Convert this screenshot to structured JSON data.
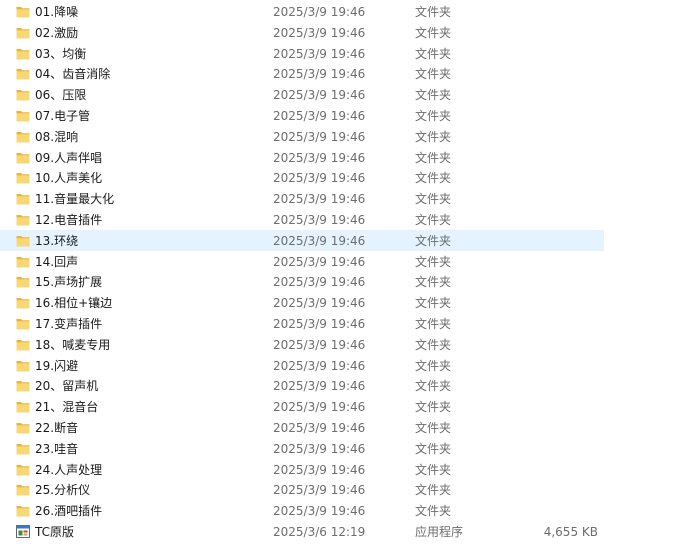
{
  "colors": {
    "folder": "#f8d775",
    "folder_dark": "#e8b53a",
    "selected_bg": "#e5f3ff",
    "meta_text": "#6d6d6d"
  },
  "files": [
    {
      "name": "01.降噪",
      "date": "2025/3/9 19:46",
      "type": "文件夹",
      "size": "",
      "icon": "folder-icon"
    },
    {
      "name": "02.激励",
      "date": "2025/3/9 19:46",
      "type": "文件夹",
      "size": "",
      "icon": "folder-icon"
    },
    {
      "name": "03、均衡",
      "date": "2025/3/9 19:46",
      "type": "文件夹",
      "size": "",
      "icon": "folder-icon"
    },
    {
      "name": "04、齿音消除",
      "date": "2025/3/9 19:46",
      "type": "文件夹",
      "size": "",
      "icon": "folder-icon"
    },
    {
      "name": "06、压限",
      "date": "2025/3/9 19:46",
      "type": "文件夹",
      "size": "",
      "icon": "folder-icon"
    },
    {
      "name": "07.电子管",
      "date": "2025/3/9 19:46",
      "type": "文件夹",
      "size": "",
      "icon": "folder-icon"
    },
    {
      "name": "08.混响",
      "date": "2025/3/9 19:46",
      "type": "文件夹",
      "size": "",
      "icon": "folder-icon"
    },
    {
      "name": "09.人声伴唱",
      "date": "2025/3/9 19:46",
      "type": "文件夹",
      "size": "",
      "icon": "folder-icon"
    },
    {
      "name": "10.人声美化",
      "date": "2025/3/9 19:46",
      "type": "文件夹",
      "size": "",
      "icon": "folder-icon"
    },
    {
      "name": "11.音量最大化",
      "date": "2025/3/9 19:46",
      "type": "文件夹",
      "size": "",
      "icon": "folder-icon"
    },
    {
      "name": "12.电音插件",
      "date": "2025/3/9 19:46",
      "type": "文件夹",
      "size": "",
      "icon": "folder-icon"
    },
    {
      "name": "13.环绕",
      "date": "2025/3/9 19:46",
      "type": "文件夹",
      "size": "",
      "icon": "folder-icon",
      "selected": true
    },
    {
      "name": "14.回声",
      "date": "2025/3/9 19:46",
      "type": "文件夹",
      "size": "",
      "icon": "folder-icon"
    },
    {
      "name": "15.声场扩展",
      "date": "2025/3/9 19:46",
      "type": "文件夹",
      "size": "",
      "icon": "folder-icon"
    },
    {
      "name": "16.相位+镶边",
      "date": "2025/3/9 19:46",
      "type": "文件夹",
      "size": "",
      "icon": "folder-icon"
    },
    {
      "name": "17.变声插件",
      "date": "2025/3/9 19:46",
      "type": "文件夹",
      "size": "",
      "icon": "folder-icon"
    },
    {
      "name": "18、喊麦专用",
      "date": "2025/3/9 19:46",
      "type": "文件夹",
      "size": "",
      "icon": "folder-icon"
    },
    {
      "name": "19.闪避",
      "date": "2025/3/9 19:46",
      "type": "文件夹",
      "size": "",
      "icon": "folder-icon"
    },
    {
      "name": "20、留声机",
      "date": "2025/3/9 19:46",
      "type": "文件夹",
      "size": "",
      "icon": "folder-icon"
    },
    {
      "name": "21、混音台",
      "date": "2025/3/9 19:46",
      "type": "文件夹",
      "size": "",
      "icon": "folder-icon"
    },
    {
      "name": "22.断音",
      "date": "2025/3/9 19:46",
      "type": "文件夹",
      "size": "",
      "icon": "folder-icon"
    },
    {
      "name": "23.哇音",
      "date": "2025/3/9 19:46",
      "type": "文件夹",
      "size": "",
      "icon": "folder-icon"
    },
    {
      "name": "24.人声处理",
      "date": "2025/3/9 19:46",
      "type": "文件夹",
      "size": "",
      "icon": "folder-icon"
    },
    {
      "name": "25.分析仪",
      "date": "2025/3/9 19:46",
      "type": "文件夹",
      "size": "",
      "icon": "folder-icon"
    },
    {
      "name": "26.酒吧插件",
      "date": "2025/3/9 19:46",
      "type": "文件夹",
      "size": "",
      "icon": "folder-icon"
    },
    {
      "name": "TC原版",
      "date": "2025/3/6 12:19",
      "type": "应用程序",
      "size": "4,655 KB",
      "icon": "application-icon"
    }
  ]
}
